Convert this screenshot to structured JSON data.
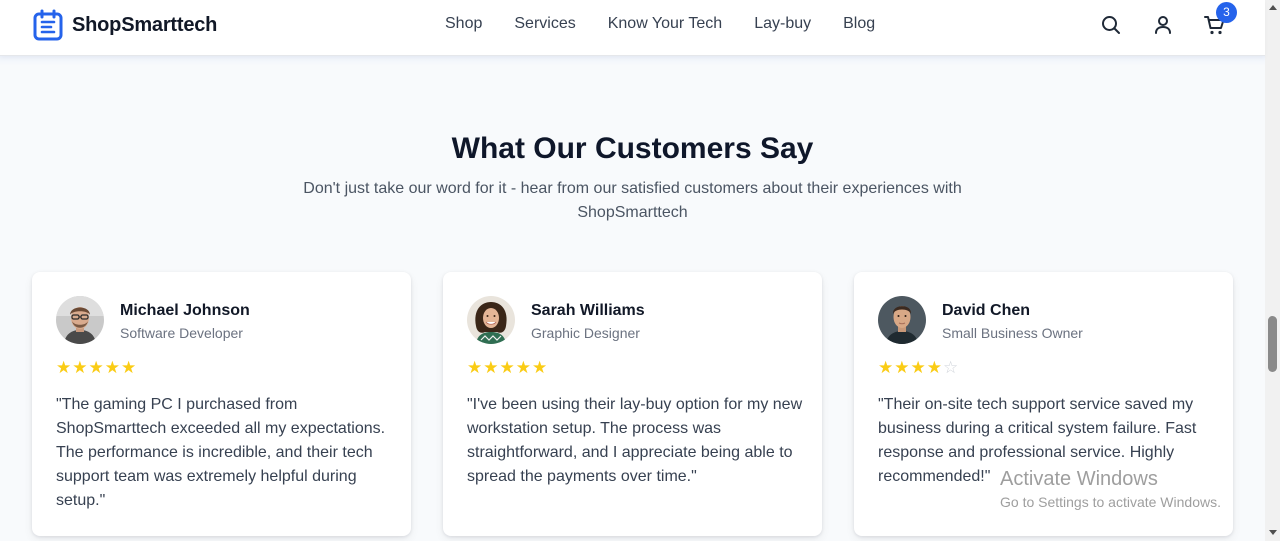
{
  "brand": {
    "name": "ShopSmarttech",
    "accent_color": "#2563eb",
    "logo_icon": "calendar-list-icon"
  },
  "nav": {
    "items": [
      {
        "label": "Shop"
      },
      {
        "label": "Services"
      },
      {
        "label": "Know Your Tech"
      },
      {
        "label": "Lay-buy"
      },
      {
        "label": "Blog"
      }
    ]
  },
  "header_actions": {
    "search_icon": "search-icon",
    "account_icon": "user-icon",
    "cart_icon": "cart-icon",
    "cart_count": "3"
  },
  "testimonials": {
    "title": "What Our Customers Say",
    "subtitle": "Don't just take our word for it - hear from our satisfied customers about their experiences with ShopSmarttech",
    "star_color": "#facc15",
    "cards": [
      {
        "name": "Michael Johnson",
        "role": "Software Developer",
        "rating": 5,
        "max_rating": 5,
        "quote": "\"The gaming PC I purchased from ShopSmarttech exceeded all my expectations. The performance is incredible, and their tech support team was extremely helpful during setup.\""
      },
      {
        "name": "Sarah Williams",
        "role": "Graphic Designer",
        "rating": 5,
        "max_rating": 5,
        "quote": "\"I've been using their lay-buy option for my new workstation setup. The process was straightforward, and I appreciate being able to spread the payments over time.\""
      },
      {
        "name": "David Chen",
        "role": "Small Business Owner",
        "rating": 4,
        "max_rating": 5,
        "quote": "\"Their on-site tech support service saved my business during a critical system failure. Fast response and professional service. Highly recommended!\""
      }
    ]
  },
  "watermark": {
    "title": "Activate Windows",
    "subtitle": "Go to Settings to activate Windows."
  }
}
